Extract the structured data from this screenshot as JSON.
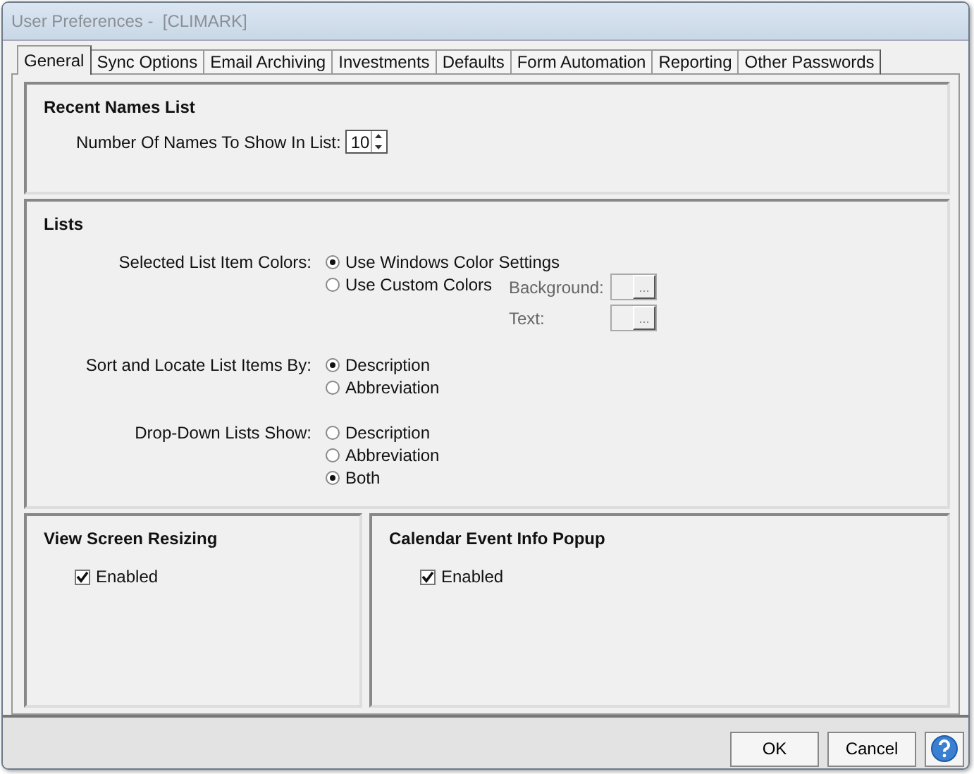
{
  "window": {
    "title": "User Preferences -  [CLIMARK]"
  },
  "tabs": [
    {
      "label": "General",
      "selected": true
    },
    {
      "label": "Sync Options",
      "selected": false
    },
    {
      "label": "Email Archiving",
      "selected": false
    },
    {
      "label": "Investments",
      "selected": false
    },
    {
      "label": "Defaults",
      "selected": false
    },
    {
      "label": "Form Automation",
      "selected": false
    },
    {
      "label": "Reporting",
      "selected": false
    },
    {
      "label": "Other Passwords",
      "selected": false
    }
  ],
  "recent_names": {
    "heading": "Recent Names List",
    "label": "Number Of Names To Show In List:",
    "value": "10"
  },
  "lists": {
    "heading": "Lists",
    "groups": [
      {
        "label": "Selected List Item Colors:",
        "options": [
          {
            "label": "Use Windows Color Settings",
            "selected": true
          },
          {
            "label": "Use Custom Colors",
            "selected": false
          }
        ],
        "color_fields": [
          {
            "label": "Background:",
            "button": "..."
          },
          {
            "label": "Text:",
            "button": "..."
          }
        ]
      },
      {
        "label": "Sort and Locate List Items By:",
        "options": [
          {
            "label": "Description",
            "selected": true
          },
          {
            "label": "Abbreviation",
            "selected": false
          }
        ]
      },
      {
        "label": "Drop-Down Lists Show:",
        "options": [
          {
            "label": "Description",
            "selected": false
          },
          {
            "label": "Abbreviation",
            "selected": false
          },
          {
            "label": "Both",
            "selected": true
          }
        ]
      }
    ]
  },
  "panels": [
    {
      "heading": "View Screen Resizing",
      "checkbox": {
        "label": "Enabled",
        "checked": true
      }
    },
    {
      "heading": "Calendar Event Info Popup",
      "checkbox": {
        "label": "Enabled",
        "checked": true
      }
    }
  ],
  "buttons": [
    {
      "label": "OK"
    },
    {
      "label": "Cancel"
    }
  ]
}
